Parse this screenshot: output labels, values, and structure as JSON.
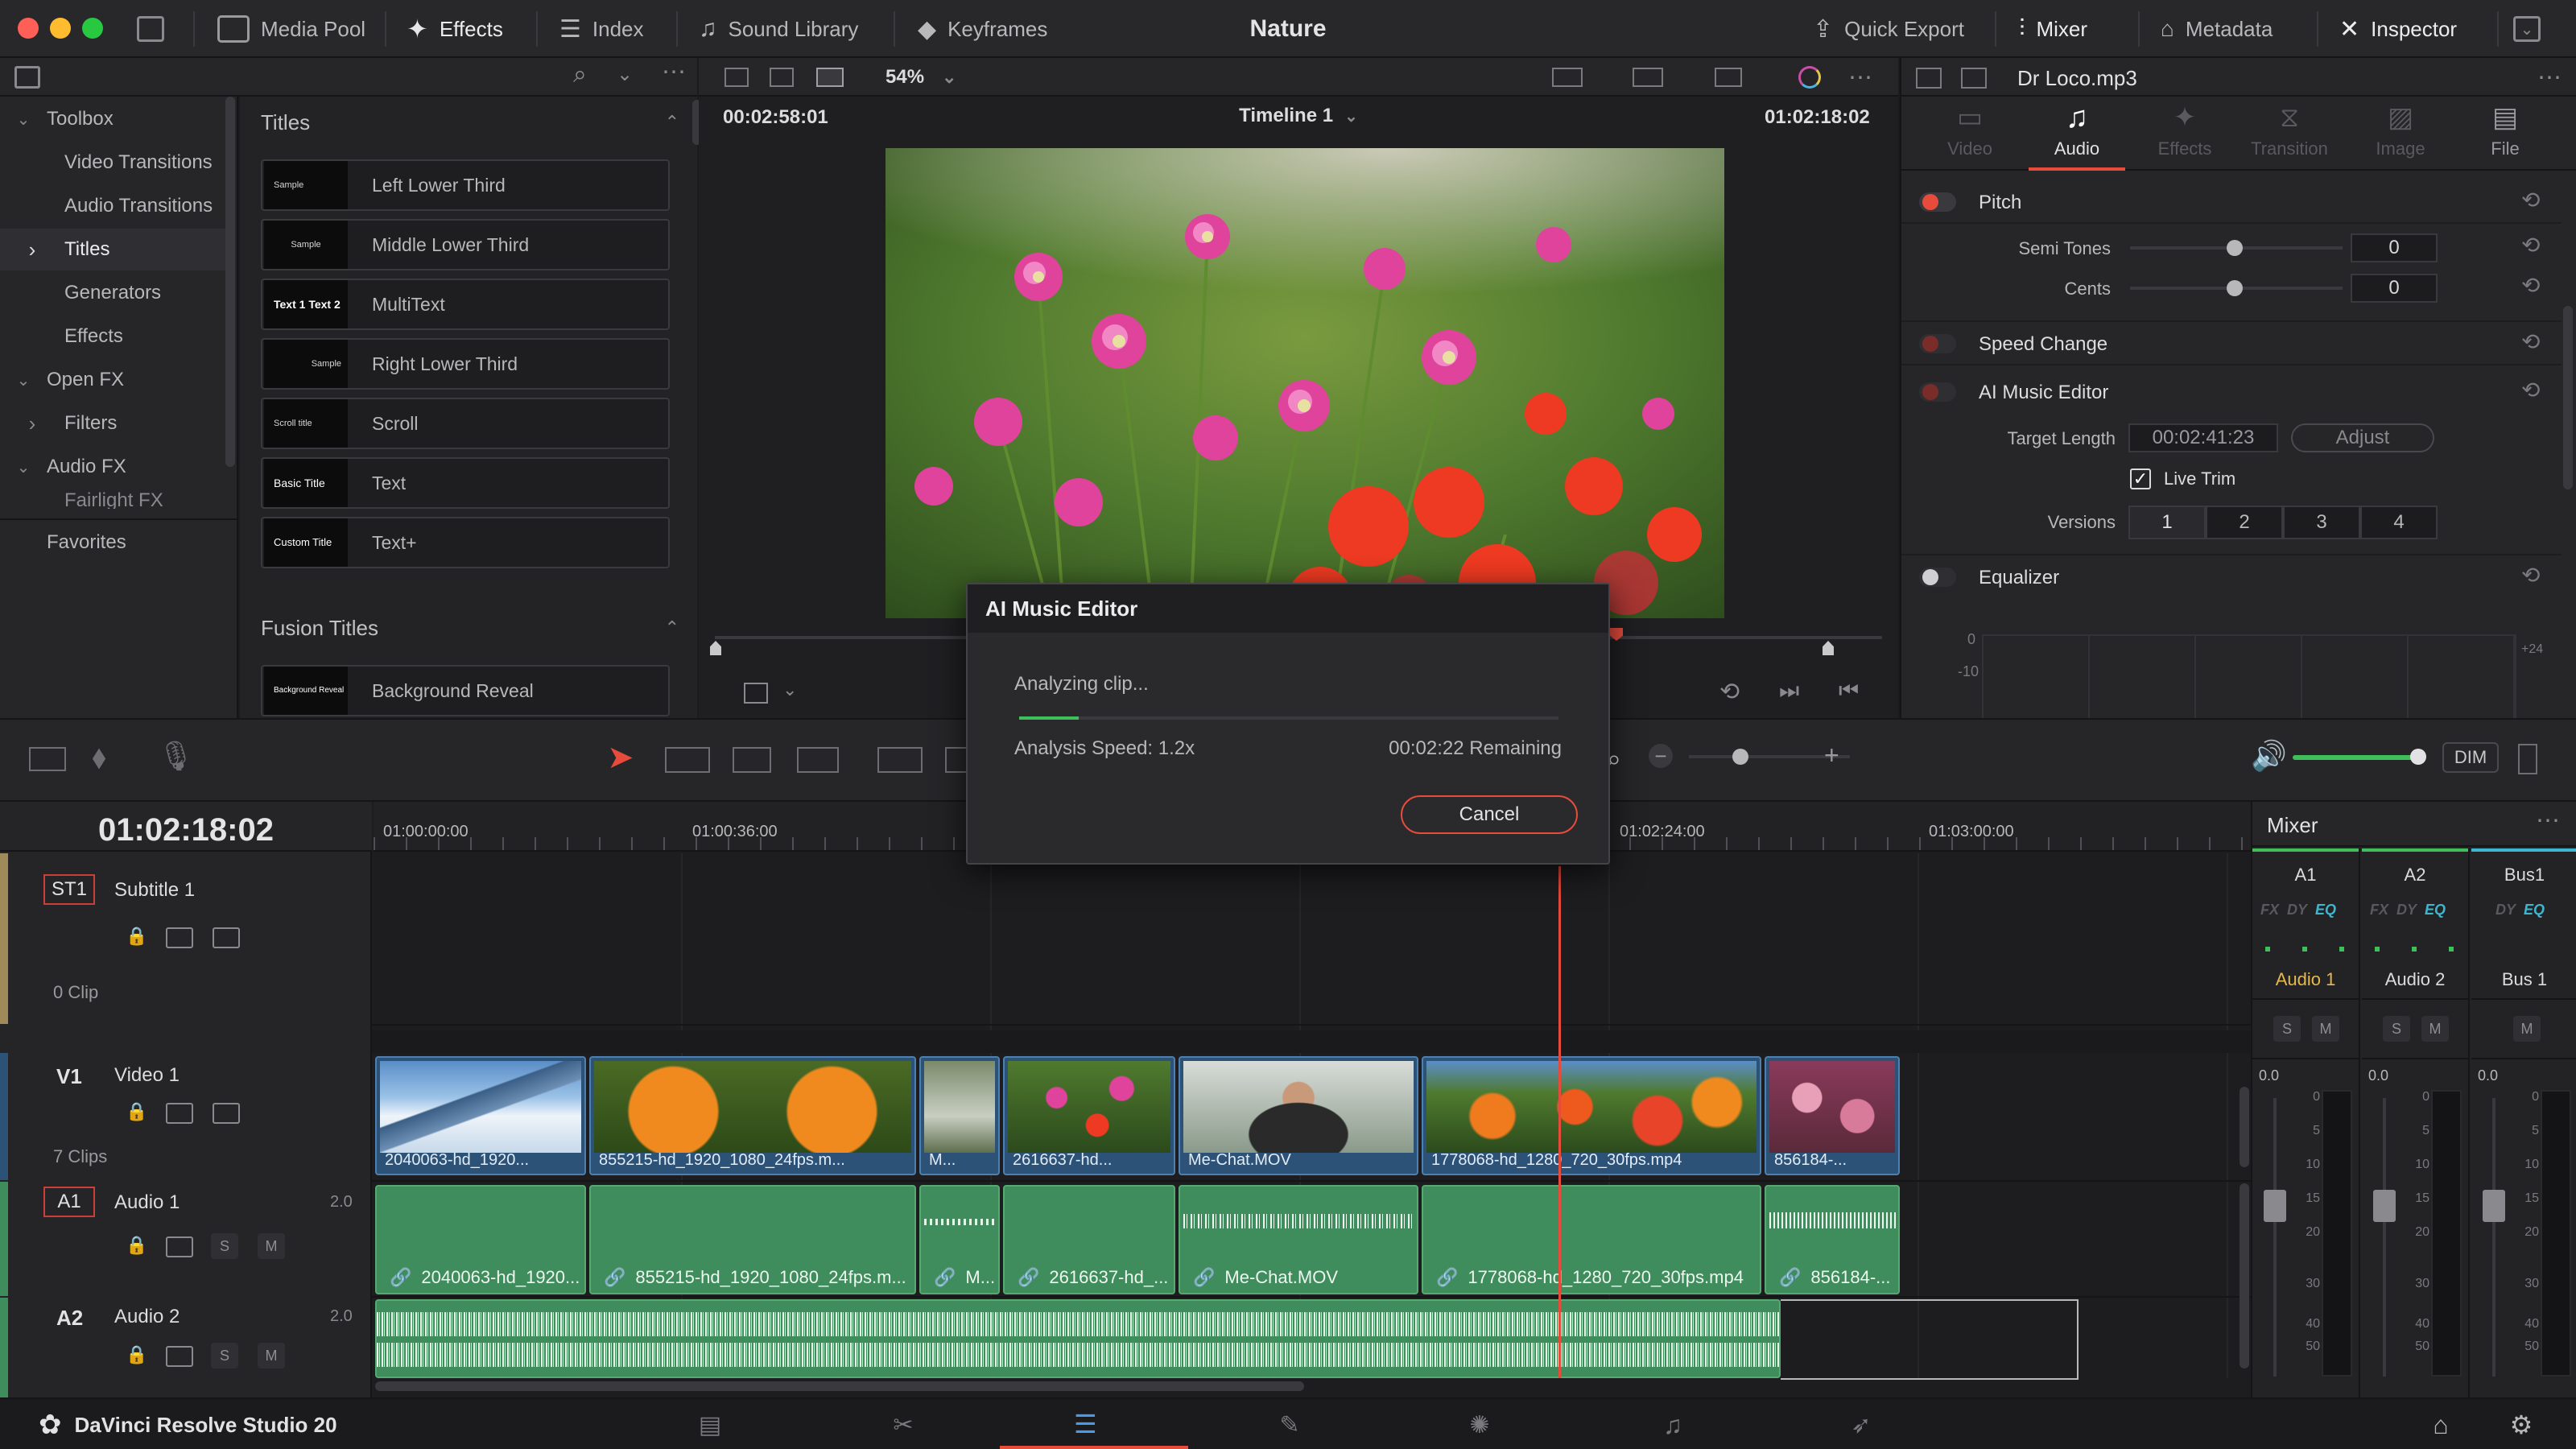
{
  "app": {
    "project_title": "Nature",
    "brand": "DaVinci Resolve Studio 20"
  },
  "topbar": {
    "media_pool": "Media Pool",
    "effects": "Effects",
    "index": "Index",
    "sound_library": "Sound Library",
    "keyframes": "Keyframes",
    "quick_export": "Quick Export",
    "mixer": "Mixer",
    "metadata": "Metadata",
    "inspector": "Inspector"
  },
  "toolbox": {
    "items": [
      {
        "label": "Toolbox"
      },
      {
        "label": "Video Transitions"
      },
      {
        "label": "Audio Transitions"
      },
      {
        "label": "Titles"
      },
      {
        "label": "Generators"
      },
      {
        "label": "Effects"
      },
      {
        "label": "Open FX"
      },
      {
        "label": "Filters"
      },
      {
        "label": "Audio FX"
      },
      {
        "label": "Fairlight FX"
      }
    ],
    "favorites": "Favorites"
  },
  "effects": {
    "section_titles": "Titles",
    "section_fusion": "Fusion Titles",
    "titles": [
      {
        "label": "Left Lower Third",
        "thumb": "Sample"
      },
      {
        "label": "Middle Lower Third",
        "thumb": "Sample"
      },
      {
        "label": "MultiText",
        "thumb": "Text 1 Text 2"
      },
      {
        "label": "Right Lower Third",
        "thumb": "Sample"
      },
      {
        "label": "Scroll",
        "thumb": "Scroll title"
      },
      {
        "label": "Text",
        "thumb": "Basic Title"
      },
      {
        "label": "Text+",
        "thumb": "Custom Title"
      }
    ],
    "fusion": [
      {
        "label": "Background Reveal",
        "thumb": "Background Reveal"
      }
    ]
  },
  "viewer": {
    "zoom": "54%",
    "source_tc": "00:02:58:01",
    "timeline_name": "Timeline 1",
    "record_tc": "01:02:18:02"
  },
  "inspector": {
    "clip_name": "Dr Loco.mp3",
    "tabs": [
      "Video",
      "Audio",
      "Effects",
      "Transition",
      "Image",
      "File"
    ],
    "active_tab": "Audio",
    "pitch": "Pitch",
    "semi_tones_label": "Semi Tones",
    "semi_tones_value": "0",
    "cents_label": "Cents",
    "cents_value": "0",
    "speed_change": "Speed Change",
    "ai_music_editor": "AI Music Editor",
    "target_length_label": "Target Length",
    "target_length_value": "00:02:41:23",
    "adjust": "Adjust",
    "live_trim": "Live Trim",
    "versions_label": "Versions",
    "versions": [
      "1",
      "2",
      "3",
      "4"
    ],
    "equalizer": "Equalizer",
    "eq_scale": [
      "0",
      "-10",
      "+24"
    ]
  },
  "dialog": {
    "title": "AI Music Editor",
    "status": "Analyzing clip...",
    "progress": 0.11,
    "speed": "Analysis Speed: 1.2x",
    "remaining": "00:02:22 Remaining",
    "cancel": "Cancel"
  },
  "timeline": {
    "timecode": "01:02:18:02",
    "ruler": [
      "01:00:00:00",
      "01:00:36:00",
      "01:02:24:00",
      "01:03:00:00"
    ],
    "tracks": {
      "st1": {
        "id": "ST1",
        "name": "Subtitle 1",
        "count": "0 Clip"
      },
      "v1": {
        "id": "V1",
        "name": "Video 1",
        "count": "7 Clips"
      },
      "a1": {
        "id": "A1",
        "name": "Audio 1",
        "channels": "2.0"
      },
      "a2": {
        "id": "A2",
        "name": "Audio 2",
        "channels": "2.0"
      }
    },
    "video_clips": [
      "2040063-hd_1920...",
      "855215-hd_1920_1080_24fps.m...",
      "M...",
      "2616637-hd...",
      "Me-Chat.MOV",
      "1778068-hd_1280_720_30fps.mp4",
      "856184-..."
    ],
    "audio_clips": [
      "2040063-hd_1920...",
      "855215-hd_1920_1080_24fps.m...",
      "M...",
      "2616637-hd_...",
      "Me-Chat.MOV",
      "1778068-hd_1280_720_30fps.mp4",
      "856184-..."
    ],
    "dim": "DIM",
    "solo": "S",
    "mute": "M"
  },
  "mixer": {
    "title": "Mixer",
    "channels": [
      "A1",
      "A2",
      "Bus1"
    ],
    "channel_names": [
      "Audio 1",
      "Audio 2",
      "Bus 1"
    ],
    "fx_labels": [
      "FX",
      "DY",
      "EQ"
    ],
    "levels": [
      "0.0",
      "0.0",
      "0.0"
    ],
    "scale": [
      "0",
      "5",
      "10",
      "15",
      "20",
      "30",
      "40",
      "50"
    ]
  }
}
